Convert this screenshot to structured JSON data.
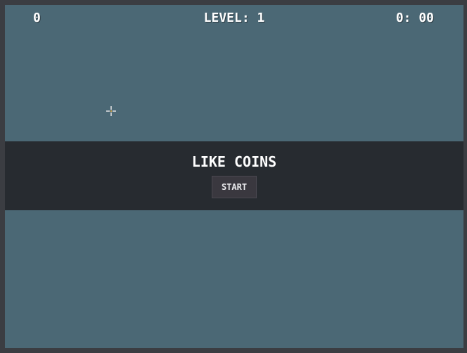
{
  "hud": {
    "score": "0",
    "level": "LEVEL: 1",
    "time": "0: 00"
  },
  "banner": {
    "title": "LIKE COINS",
    "start_label": "START"
  },
  "colors": {
    "background": "#4b6875",
    "banner": "#272b30",
    "button": "#3a383f",
    "text": "#ffffff"
  },
  "icons": {
    "cursor": "crosshair-cursor-icon"
  }
}
